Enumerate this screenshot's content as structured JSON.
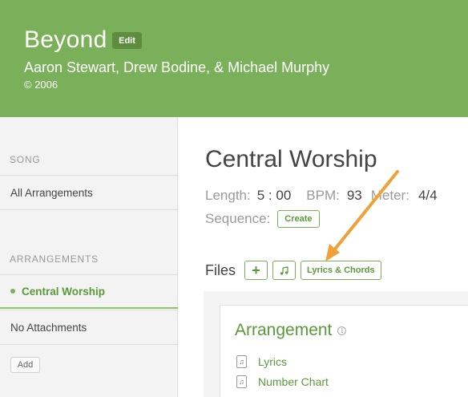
{
  "song": {
    "title": "Beyond",
    "edit_label": "Edit",
    "authors": "Aaron Stewart, Drew Bodine, & Michael Murphy",
    "copyright": "© 2006"
  },
  "sidebar": {
    "song_heading": "SONG",
    "all_arrangements": "All Arrangements",
    "arrangements_heading": "ARRANGEMENTS",
    "items": [
      {
        "label": "Central Worship",
        "active": true
      },
      {
        "label": "No Attachments",
        "active": false
      }
    ],
    "add_label": "Add"
  },
  "arrangement": {
    "title": "Central Worship",
    "length_label": "Length:",
    "length_value": "5 : 00",
    "bpm_label": "BPM:",
    "bpm_value": "93",
    "meter_label": "Meter:",
    "meter_value": "4/4",
    "sequence_label": "Sequence:",
    "create_label": "Create"
  },
  "files": {
    "label": "Files",
    "add_icon": "plus-icon",
    "note_icon": "music-note-icon",
    "lyrics_chords_label": "Lyrics & Chords"
  },
  "card": {
    "title": "Arrangement",
    "links": [
      "Lyrics",
      "Number Chart"
    ]
  },
  "colors": {
    "brand_green": "#7bb05a",
    "dark_green": "#5e8d3f",
    "link_green": "#5a9a3a",
    "arrow_orange": "#f0a035"
  }
}
